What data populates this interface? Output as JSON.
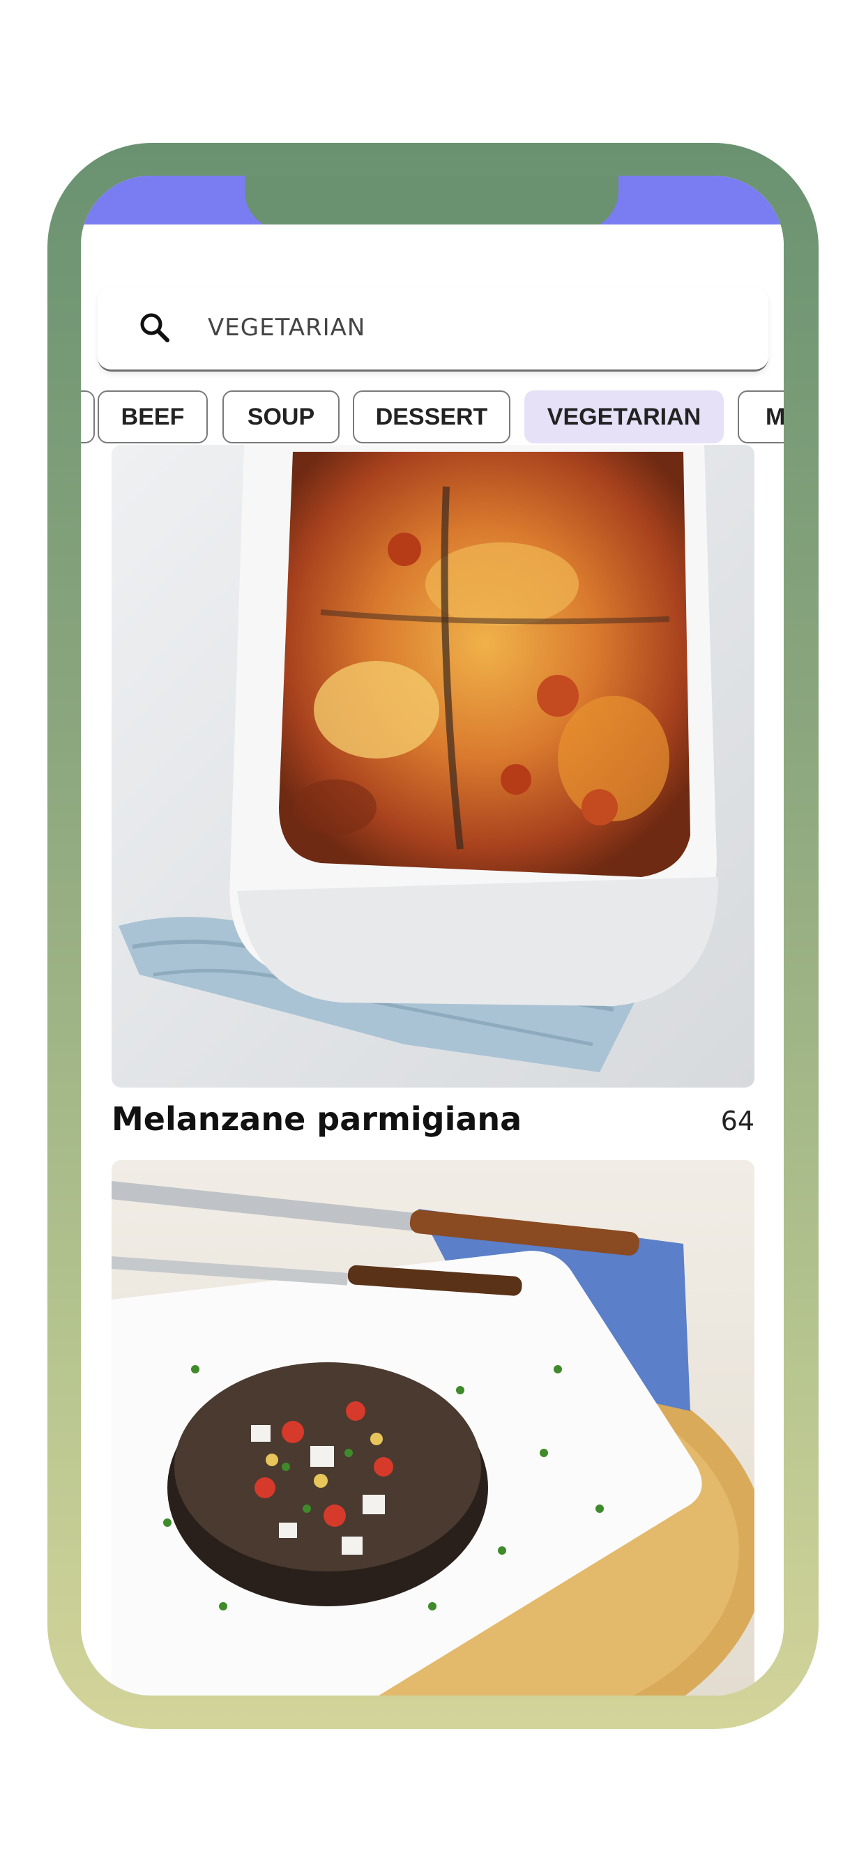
{
  "search": {
    "query": "VEGETARIAN",
    "icon": "search-icon"
  },
  "categories": [
    {
      "label": "BEEF",
      "selected": false
    },
    {
      "label": "SOUP",
      "selected": false
    },
    {
      "label": "DESSERT",
      "selected": false
    },
    {
      "label": "VEGETARIAN",
      "selected": true
    },
    {
      "label": "M",
      "selected": false
    }
  ],
  "recipes": [
    {
      "title": "Melanzane parmigiana",
      "count": "64",
      "image": "aubergine parmigiana baked in white dish"
    },
    {
      "title": "",
      "count": "",
      "image": "stuffed portobello mushroom on white plate"
    }
  ],
  "colors": {
    "status_bar": "#7a7cf2",
    "frame_top": "#6a9271",
    "frame_bottom": "#d3d49a",
    "chip_selected": "#e6e1f7"
  }
}
